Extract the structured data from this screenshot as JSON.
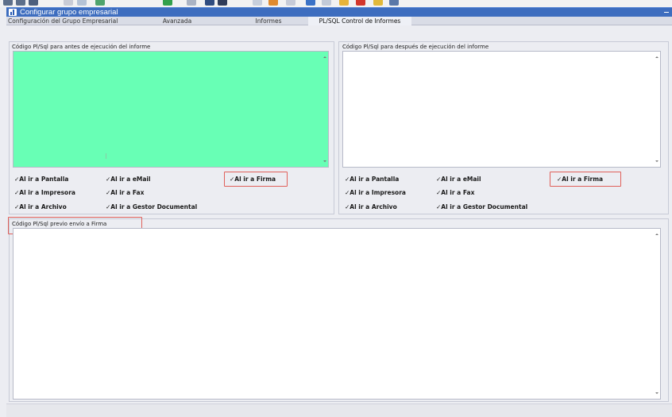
{
  "window": {
    "title": "Configurar grupo empresarial"
  },
  "tabs": [
    {
      "label": "Configuración del Grupo Empresarial"
    },
    {
      "label": "Avanzada"
    },
    {
      "label": "Informes"
    },
    {
      "label": "PL/SQL Control de Informes"
    }
  ],
  "before_group": {
    "label": "Código Pl/Sql para antes de ejecución del informe",
    "editor_color": "#68ffb5",
    "checks": {
      "pantalla": "✓Al ir a Pantalla",
      "email": "✓Al ir a eMail",
      "firma": "✓Al ir a Firma",
      "impresora": "✓Al ir a Impresora",
      "fax": "✓Al ir a Fax",
      "archivo": "✓Al ir a Archivo",
      "gestor": "✓Al ir a Gestor Documental"
    }
  },
  "after_group": {
    "label": "Código Pl/Sql para después de ejecución del informe",
    "checks": {
      "pantalla": "✓Al ir a Pantalla",
      "email": "✓Al ir a eMail",
      "firma": "✓Al ir a Firma",
      "impresora": "✓Al ir a Impresora",
      "fax": "✓Al ir a Fax",
      "archivo": "✓Al ir a Archivo",
      "gestor": "✓Al ir a Gestor Documental"
    }
  },
  "firma_group": {
    "label": "Código Pl/Sql previo envío a Firma"
  },
  "colors": {
    "titlebar": "#3d6dbf",
    "highlight": "#e0605a",
    "green_editor": "#68ffb5"
  }
}
